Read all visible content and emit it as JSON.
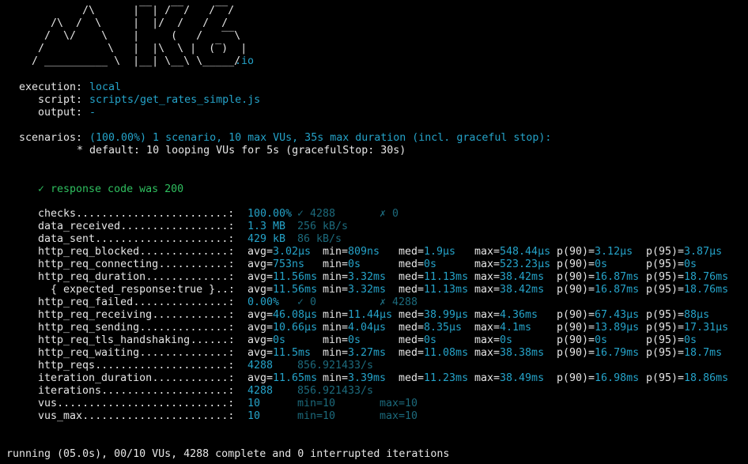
{
  "logo": {
    "lines": [
      "          /\\      |‾‾| /‾‾/   /‾‾/",
      "     /\\  /  \\     |  |/  /   /  /",
      "    /  \\/    \\    |     (   /   ‾‾\\",
      "   /          \\   |  |\\  \\ |  (‾)  |",
      "  / __________ \\  |__| \\__\\ \\_____/"
    ],
    "suffix": ".io"
  },
  "execution": {
    "execution_label": "execution:",
    "execution_value": "local",
    "script_label": "script:",
    "script_value": "scripts/get_rates_simple.js",
    "output_label": "output:",
    "output_value": "-"
  },
  "scenarios": {
    "label": "scenarios:",
    "summary": "(100.00%) 1 scenario, 10 max VUs, 35s max duration (incl. graceful stop):",
    "detail": "* default: 10 looping VUs for 5s (gracefulStop: 30s)"
  },
  "check_result": "✓ response code was 200",
  "metrics": [
    {
      "name": "checks",
      "cols": [
        "100.00%",
        "✓ 4288",
        "✗ 0"
      ],
      "styles": [
        "c",
        "d",
        "d"
      ]
    },
    {
      "name": "data_received",
      "cols": [
        "1.3 MB",
        "256 kB/s"
      ],
      "styles": [
        "c",
        "d"
      ]
    },
    {
      "name": "data_sent",
      "cols": [
        "429 kB",
        "86 kB/s"
      ],
      "styles": [
        "c",
        "d"
      ]
    },
    {
      "name": "http_req_blocked",
      "cols": [
        "avg=3.02µs",
        "min=809ns",
        "med=1.9µs",
        "max=548.44µs",
        "p(90)=3.12µs",
        "p(95)=3.87µs"
      ],
      "styles": [
        "kv",
        "kv",
        "kv",
        "kv",
        "kv",
        "kv"
      ]
    },
    {
      "name": "http_req_connecting",
      "cols": [
        "avg=753ns",
        "min=0s",
        "med=0s",
        "max=523.23µs",
        "p(90)=0s",
        "p(95)=0s"
      ],
      "styles": [
        "kv",
        "kv",
        "kv",
        "kv",
        "kv",
        "kv"
      ]
    },
    {
      "name": "http_req_duration",
      "cols": [
        "avg=11.56ms",
        "min=3.32ms",
        "med=11.13ms",
        "max=38.42ms",
        "p(90)=16.87ms",
        "p(95)=18.76ms"
      ],
      "styles": [
        "kv",
        "kv",
        "kv",
        "kv",
        "kv",
        "kv"
      ]
    },
    {
      "name": "  { expected_response:true }",
      "cols": [
        "avg=11.56ms",
        "min=3.32ms",
        "med=11.13ms",
        "max=38.42ms",
        "p(90)=16.87ms",
        "p(95)=18.76ms"
      ],
      "styles": [
        "kv",
        "kv",
        "kv",
        "kv",
        "kv",
        "kv"
      ]
    },
    {
      "name": "http_req_failed",
      "cols": [
        "0.00%",
        "✓ 0",
        "✗ 4288"
      ],
      "styles": [
        "c",
        "d",
        "d"
      ]
    },
    {
      "name": "http_req_receiving",
      "cols": [
        "avg=46.08µs",
        "min=11.44µs",
        "med=38.99µs",
        "max=4.36ms",
        "p(90)=67.43µs",
        "p(95)=88µs"
      ],
      "styles": [
        "kv",
        "kv",
        "kv",
        "kv",
        "kv",
        "kv"
      ]
    },
    {
      "name": "http_req_sending",
      "cols": [
        "avg=10.66µs",
        "min=4.04µs",
        "med=8.35µs",
        "max=4.1ms",
        "p(90)=13.89µs",
        "p(95)=17.31µs"
      ],
      "styles": [
        "kv",
        "kv",
        "kv",
        "kv",
        "kv",
        "kv"
      ]
    },
    {
      "name": "http_req_tls_handshaking",
      "cols": [
        "avg=0s",
        "min=0s",
        "med=0s",
        "max=0s",
        "p(90)=0s",
        "p(95)=0s"
      ],
      "styles": [
        "kv",
        "kv",
        "kv",
        "kv",
        "kv",
        "kv"
      ]
    },
    {
      "name": "http_req_waiting",
      "cols": [
        "avg=11.5ms",
        "min=3.27ms",
        "med=11.08ms",
        "max=38.38ms",
        "p(90)=16.79ms",
        "p(95)=18.7ms"
      ],
      "styles": [
        "kv",
        "kv",
        "kv",
        "kv",
        "kv",
        "kv"
      ]
    },
    {
      "name": "http_reqs",
      "cols": [
        "4288",
        "856.921433/s"
      ],
      "styles": [
        "c",
        "d"
      ]
    },
    {
      "name": "iteration_duration",
      "cols": [
        "avg=11.65ms",
        "min=3.39ms",
        "med=11.23ms",
        "max=38.49ms",
        "p(90)=16.98ms",
        "p(95)=18.86ms"
      ],
      "styles": [
        "kv",
        "kv",
        "kv",
        "kv",
        "kv",
        "kv"
      ]
    },
    {
      "name": "iterations",
      "cols": [
        "4288",
        "856.921433/s"
      ],
      "styles": [
        "c",
        "d"
      ]
    },
    {
      "name": "vus",
      "cols": [
        "10",
        "min=10",
        "max=10"
      ],
      "styles": [
        "c",
        "d",
        "d"
      ]
    },
    {
      "name": "vus_max",
      "cols": [
        "10",
        "min=10",
        "max=10"
      ],
      "styles": [
        "c",
        "d",
        "d"
      ]
    }
  ],
  "status_line": "running (05.0s), 00/10 VUs, 4288 complete and 0 interrupted iterations",
  "colors": {
    "background": "#000000",
    "text": "#e6e6e6",
    "cyan": "#25a3c9",
    "dim_cyan": "#1c6a7c",
    "green": "#2fbf5f"
  }
}
